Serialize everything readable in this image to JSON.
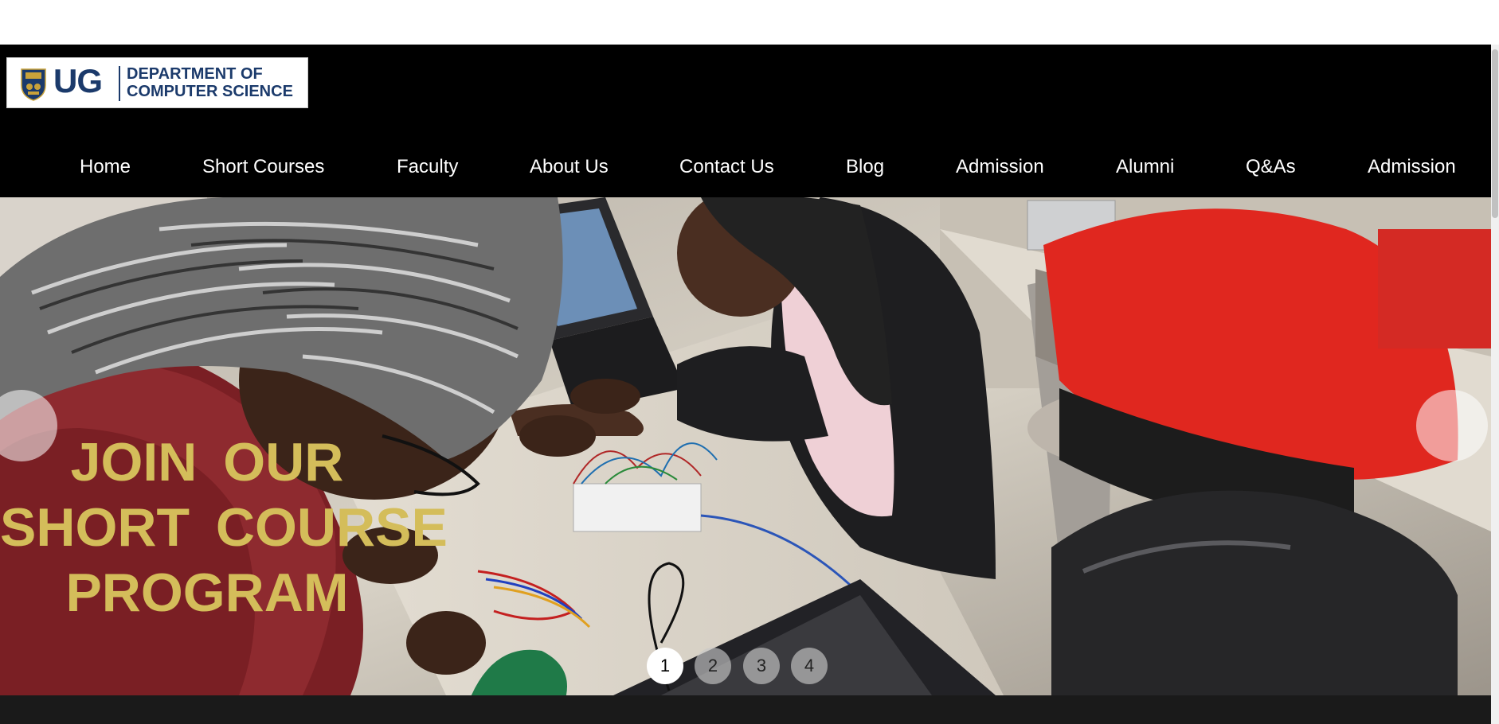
{
  "header": {
    "logo": {
      "brand": "UG",
      "line1": "DEPARTMENT OF",
      "line2": "COMPUTER SCIENCE",
      "icon": "university-crest"
    },
    "nav": [
      {
        "label": "Home"
      },
      {
        "label": "Short Courses"
      },
      {
        "label": "Faculty"
      },
      {
        "label": "About Us"
      },
      {
        "label": "Contact Us"
      },
      {
        "label": "Blog"
      },
      {
        "label": "Admission"
      },
      {
        "label": "Alumni"
      },
      {
        "label": "Q&As"
      },
      {
        "label": "Admission"
      }
    ]
  },
  "hero": {
    "title_line1": "JOIN OUR",
    "title_line2": "SHORT COURSE",
    "title_line3": "PROGRAM",
    "prev_icon": "previous-arrow",
    "next_icon": "next-arrow",
    "slides": [
      "1",
      "2",
      "3",
      "4"
    ],
    "active_slide": "1"
  },
  "colors": {
    "header_bg": "#000000",
    "brand_blue": "#1b3a6b",
    "hero_title": "#d4bd5a",
    "nav_text": "#ffffff"
  }
}
